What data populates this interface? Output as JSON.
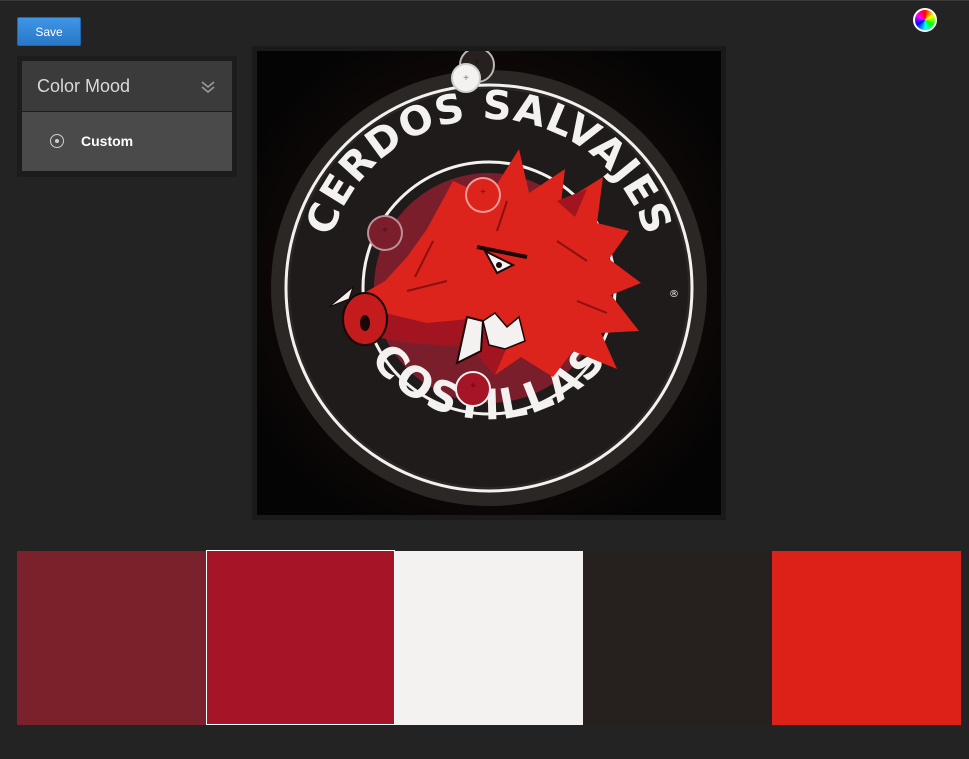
{
  "toolbar": {
    "save_label": "Save",
    "color_wheel_icon": "color-wheel-icon"
  },
  "mood": {
    "title": "Color Mood",
    "expand_icon": "double-chevron-down-icon",
    "options": [
      {
        "label": "Custom",
        "icon": "radio-icon",
        "selected": true
      }
    ]
  },
  "logo": {
    "top_text": "CERDOS SALVAJES",
    "bottom_text": "COSTILLAS",
    "registered_mark": "®",
    "colors": {
      "ring": "#2b2725",
      "band": "#1f1b1a",
      "line": "#f2f1ef",
      "boar": "#dc241c",
      "boar_dark": "#a21420",
      "inner": "#7b1e2c",
      "teeth": "#f3f2f0"
    }
  },
  "pickers": [
    {
      "name": "picker-dark",
      "color": "#26211f"
    },
    {
      "name": "picker-white",
      "color": "#f3f2f0"
    },
    {
      "name": "picker-red",
      "color": "#dc241c"
    },
    {
      "name": "picker-maroon",
      "color": "#7b1e2c"
    },
    {
      "name": "picker-crimson",
      "color": "#a51427"
    }
  ],
  "palette": {
    "swatches": [
      {
        "color": "#7b212c"
      },
      {
        "color": "#a51427",
        "selected": true
      },
      {
        "color": "#f3f2f0"
      },
      {
        "color": "#26211f"
      },
      {
        "color": "#dc2119"
      }
    ]
  }
}
